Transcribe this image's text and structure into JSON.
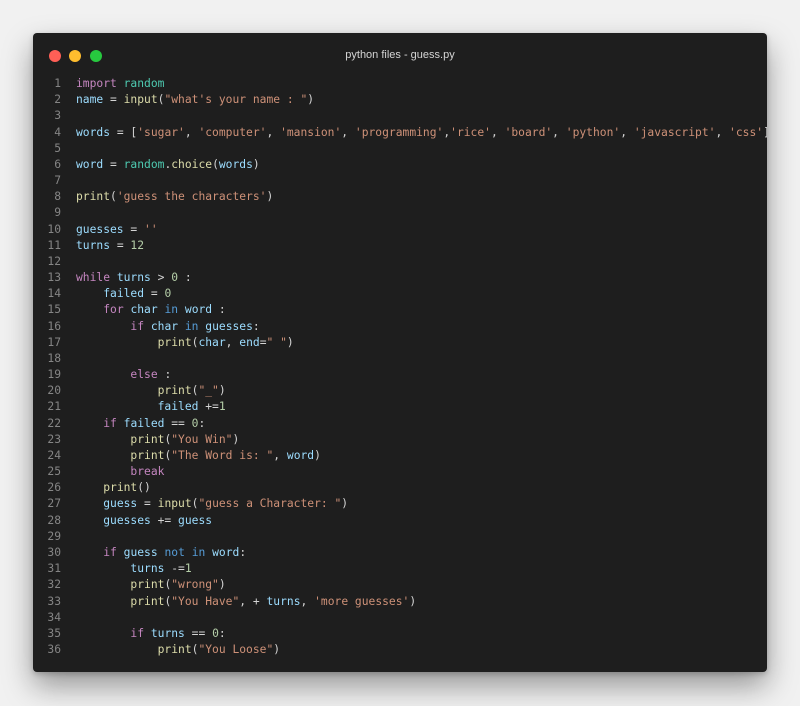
{
  "window": {
    "title": "python files - guess.py"
  },
  "colors": {
    "background": "#1e1e1e",
    "close_dot": "#ff5f56",
    "minimize_dot": "#ffbd2e",
    "maximize_dot": "#27c93f",
    "line_number": "#858585",
    "keyword_control": "#c586c0",
    "keyword_operator": "#569cd6",
    "function": "#dcdcaa",
    "variable": "#9cdcfe",
    "module": "#4ec9b0",
    "string": "#ce9178",
    "number": "#b5cea8",
    "plain": "#d4d4d4"
  },
  "editor": {
    "lines": [
      {
        "n": "1",
        "tokens": [
          [
            "kw",
            "import"
          ],
          [
            "pl",
            " "
          ],
          [
            "md",
            "random"
          ]
        ]
      },
      {
        "n": "2",
        "tokens": [
          [
            "vr",
            "name"
          ],
          [
            "pl",
            " = "
          ],
          [
            "fn",
            "input"
          ],
          [
            "pl",
            "("
          ],
          [
            "st",
            "\"what's your name : \""
          ],
          [
            "pl",
            ")"
          ]
        ]
      },
      {
        "n": "3",
        "tokens": []
      },
      {
        "n": "4",
        "tokens": [
          [
            "vr",
            "words"
          ],
          [
            "pl",
            " = ["
          ],
          [
            "st",
            "'sugar'"
          ],
          [
            "pl",
            ", "
          ],
          [
            "st",
            "'computer'"
          ],
          [
            "pl",
            ", "
          ],
          [
            "st",
            "'mansion'"
          ],
          [
            "pl",
            ", "
          ],
          [
            "st",
            "'programming'"
          ],
          [
            "pl",
            ","
          ],
          [
            "st",
            "'rice'"
          ],
          [
            "pl",
            ", "
          ],
          [
            "st",
            "'board'"
          ],
          [
            "pl",
            ", "
          ],
          [
            "st",
            "'python'"
          ],
          [
            "pl",
            ", "
          ],
          [
            "st",
            "'javascript'"
          ],
          [
            "pl",
            ", "
          ],
          [
            "st",
            "'css'"
          ],
          [
            "pl",
            "]"
          ]
        ]
      },
      {
        "n": "5",
        "tokens": []
      },
      {
        "n": "6",
        "tokens": [
          [
            "vr",
            "word"
          ],
          [
            "pl",
            " = "
          ],
          [
            "md",
            "random"
          ],
          [
            "pl",
            "."
          ],
          [
            "fn",
            "choice"
          ],
          [
            "pl",
            "("
          ],
          [
            "vr",
            "words"
          ],
          [
            "pl",
            ")"
          ]
        ]
      },
      {
        "n": "7",
        "tokens": []
      },
      {
        "n": "8",
        "tokens": [
          [
            "fn",
            "print"
          ],
          [
            "pl",
            "("
          ],
          [
            "st",
            "'guess the characters'"
          ],
          [
            "pl",
            ")"
          ]
        ]
      },
      {
        "n": "9",
        "tokens": []
      },
      {
        "n": "10",
        "tokens": [
          [
            "vr",
            "guesses"
          ],
          [
            "pl",
            " = "
          ],
          [
            "st",
            "''"
          ]
        ]
      },
      {
        "n": "11",
        "tokens": [
          [
            "vr",
            "turns"
          ],
          [
            "pl",
            " = "
          ],
          [
            "nm",
            "12"
          ]
        ]
      },
      {
        "n": "12",
        "tokens": []
      },
      {
        "n": "13",
        "tokens": [
          [
            "kw",
            "while"
          ],
          [
            "pl",
            " "
          ],
          [
            "vr",
            "turns"
          ],
          [
            "pl",
            " > "
          ],
          [
            "nm",
            "0"
          ],
          [
            "pl",
            " :"
          ]
        ]
      },
      {
        "n": "14",
        "tokens": [
          [
            "pl",
            "    "
          ],
          [
            "vr",
            "failed"
          ],
          [
            "pl",
            " = "
          ],
          [
            "nm",
            "0"
          ]
        ]
      },
      {
        "n": "15",
        "tokens": [
          [
            "pl",
            "    "
          ],
          [
            "kw",
            "for"
          ],
          [
            "pl",
            " "
          ],
          [
            "vr",
            "char"
          ],
          [
            "pl",
            " "
          ],
          [
            "kb",
            "in"
          ],
          [
            "pl",
            " "
          ],
          [
            "vr",
            "word"
          ],
          [
            "pl",
            " :"
          ]
        ]
      },
      {
        "n": "16",
        "tokens": [
          [
            "pl",
            "        "
          ],
          [
            "kw",
            "if"
          ],
          [
            "pl",
            " "
          ],
          [
            "vr",
            "char"
          ],
          [
            "pl",
            " "
          ],
          [
            "kb",
            "in"
          ],
          [
            "pl",
            " "
          ],
          [
            "vr",
            "guesses"
          ],
          [
            "pl",
            ":"
          ]
        ]
      },
      {
        "n": "17",
        "tokens": [
          [
            "pl",
            "            "
          ],
          [
            "fn",
            "print"
          ],
          [
            "pl",
            "("
          ],
          [
            "vr",
            "char"
          ],
          [
            "pl",
            ", "
          ],
          [
            "vr",
            "end"
          ],
          [
            "pl",
            "="
          ],
          [
            "st",
            "\" \""
          ],
          [
            "pl",
            ")"
          ]
        ]
      },
      {
        "n": "18",
        "tokens": []
      },
      {
        "n": "19",
        "tokens": [
          [
            "pl",
            "        "
          ],
          [
            "kw",
            "else"
          ],
          [
            "pl",
            " :"
          ]
        ]
      },
      {
        "n": "20",
        "tokens": [
          [
            "pl",
            "            "
          ],
          [
            "fn",
            "print"
          ],
          [
            "pl",
            "("
          ],
          [
            "st",
            "\"_\""
          ],
          [
            "pl",
            ")"
          ]
        ]
      },
      {
        "n": "21",
        "tokens": [
          [
            "pl",
            "            "
          ],
          [
            "vr",
            "failed"
          ],
          [
            "pl",
            " +="
          ],
          [
            "nm",
            "1"
          ]
        ]
      },
      {
        "n": "22",
        "tokens": [
          [
            "pl",
            "    "
          ],
          [
            "kw",
            "if"
          ],
          [
            "pl",
            " "
          ],
          [
            "vr",
            "failed"
          ],
          [
            "pl",
            " == "
          ],
          [
            "nm",
            "0"
          ],
          [
            "pl",
            ":"
          ]
        ]
      },
      {
        "n": "23",
        "tokens": [
          [
            "pl",
            "        "
          ],
          [
            "fn",
            "print"
          ],
          [
            "pl",
            "("
          ],
          [
            "st",
            "\"You Win\""
          ],
          [
            "pl",
            ")"
          ]
        ]
      },
      {
        "n": "24",
        "tokens": [
          [
            "pl",
            "        "
          ],
          [
            "fn",
            "print"
          ],
          [
            "pl",
            "("
          ],
          [
            "st",
            "\"The Word is: \""
          ],
          [
            "pl",
            ", "
          ],
          [
            "vr",
            "word"
          ],
          [
            "pl",
            ")"
          ]
        ]
      },
      {
        "n": "25",
        "tokens": [
          [
            "pl",
            "        "
          ],
          [
            "kw",
            "break"
          ]
        ]
      },
      {
        "n": "26",
        "tokens": [
          [
            "pl",
            "    "
          ],
          [
            "fn",
            "print"
          ],
          [
            "pl",
            "()"
          ]
        ]
      },
      {
        "n": "27",
        "tokens": [
          [
            "pl",
            "    "
          ],
          [
            "vr",
            "guess"
          ],
          [
            "pl",
            " = "
          ],
          [
            "fn",
            "input"
          ],
          [
            "pl",
            "("
          ],
          [
            "st",
            "\"guess a Character: \""
          ],
          [
            "pl",
            ")"
          ]
        ]
      },
      {
        "n": "28",
        "tokens": [
          [
            "pl",
            "    "
          ],
          [
            "vr",
            "guesses"
          ],
          [
            "pl",
            " += "
          ],
          [
            "vr",
            "guess"
          ]
        ]
      },
      {
        "n": "29",
        "tokens": []
      },
      {
        "n": "30",
        "tokens": [
          [
            "pl",
            "    "
          ],
          [
            "kw",
            "if"
          ],
          [
            "pl",
            " "
          ],
          [
            "vr",
            "guess"
          ],
          [
            "pl",
            " "
          ],
          [
            "kb",
            "not"
          ],
          [
            "pl",
            " "
          ],
          [
            "kb",
            "in"
          ],
          [
            "pl",
            " "
          ],
          [
            "vr",
            "word"
          ],
          [
            "pl",
            ":"
          ]
        ]
      },
      {
        "n": "31",
        "tokens": [
          [
            "pl",
            "        "
          ],
          [
            "vr",
            "turns"
          ],
          [
            "pl",
            " -="
          ],
          [
            "nm",
            "1"
          ]
        ]
      },
      {
        "n": "32",
        "tokens": [
          [
            "pl",
            "        "
          ],
          [
            "fn",
            "print"
          ],
          [
            "pl",
            "("
          ],
          [
            "st",
            "\"wrong\""
          ],
          [
            "pl",
            ")"
          ]
        ]
      },
      {
        "n": "33",
        "tokens": [
          [
            "pl",
            "        "
          ],
          [
            "fn",
            "print"
          ],
          [
            "pl",
            "("
          ],
          [
            "st",
            "\"You Have\""
          ],
          [
            "pl",
            ", + "
          ],
          [
            "vr",
            "turns"
          ],
          [
            "pl",
            ", "
          ],
          [
            "st",
            "'more guesses'"
          ],
          [
            "pl",
            ")"
          ]
        ]
      },
      {
        "n": "34",
        "tokens": []
      },
      {
        "n": "35",
        "tokens": [
          [
            "pl",
            "        "
          ],
          [
            "kw",
            "if"
          ],
          [
            "pl",
            " "
          ],
          [
            "vr",
            "turns"
          ],
          [
            "pl",
            " == "
          ],
          [
            "nm",
            "0"
          ],
          [
            "pl",
            ":"
          ]
        ]
      },
      {
        "n": "36",
        "tokens": [
          [
            "pl",
            "            "
          ],
          [
            "fn",
            "print"
          ],
          [
            "pl",
            "("
          ],
          [
            "st",
            "\"You Loose\""
          ],
          [
            "pl",
            ")"
          ]
        ]
      }
    ]
  }
}
